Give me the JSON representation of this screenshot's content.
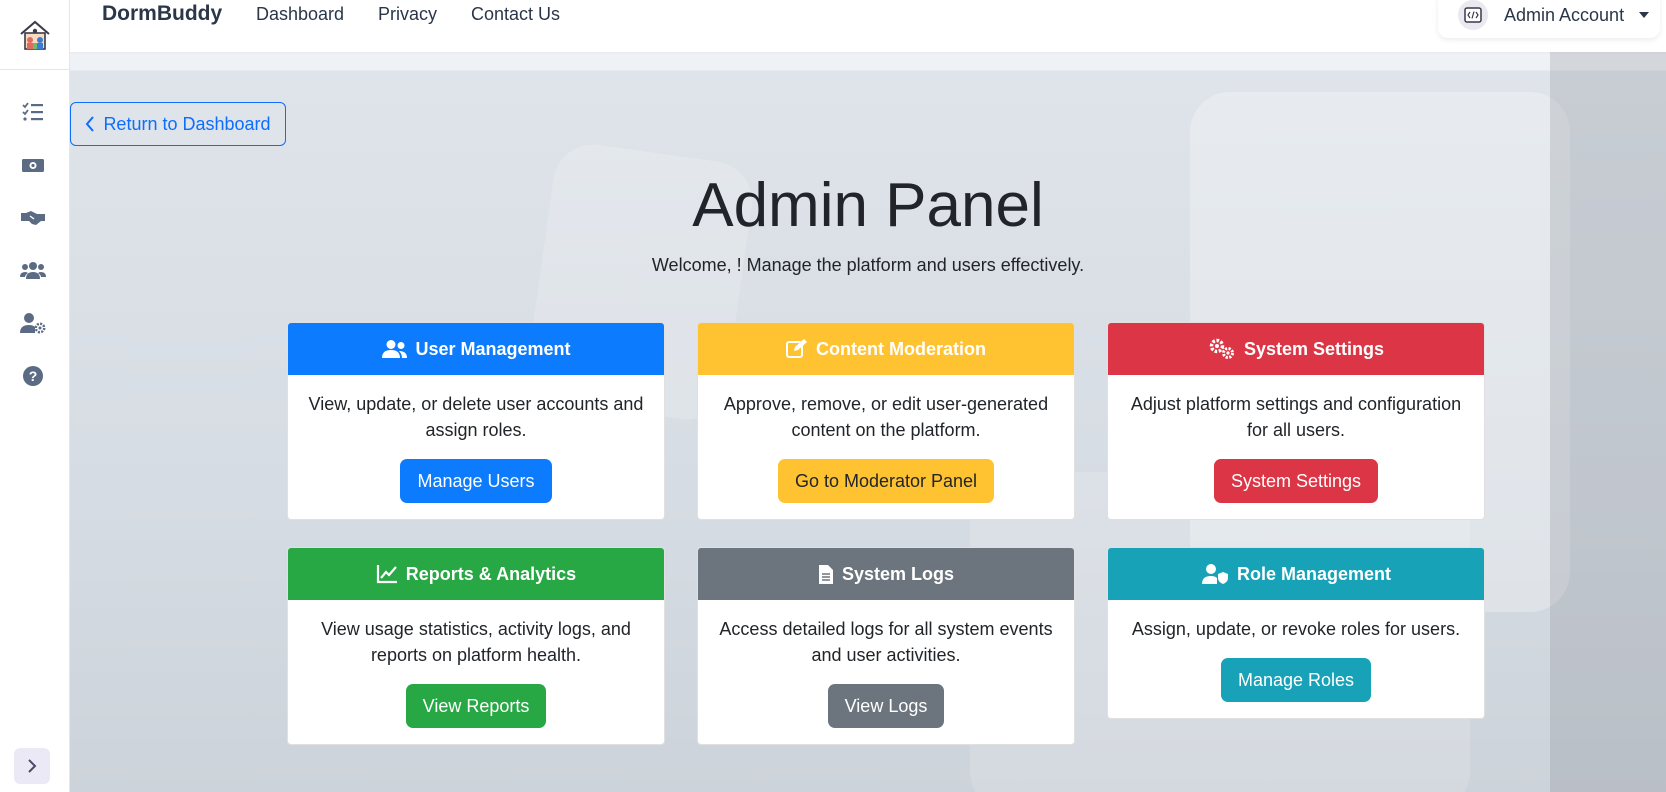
{
  "header": {
    "brand": "DormBuddy",
    "nav": [
      "Dashboard",
      "Privacy",
      "Contact Us"
    ],
    "account_name": "Admin Account"
  },
  "sidebar": {
    "icons": [
      "house-logo-icon",
      "tasks-list-icon",
      "money-icon",
      "handshake-icon",
      "users-icon",
      "user-gear-icon",
      "help-icon"
    ],
    "expand_icon": "chevron-right-icon"
  },
  "main": {
    "back_label": "Return to Dashboard",
    "title": "Admin Panel",
    "welcome": "Welcome, ! Manage the platform and users effectively."
  },
  "cards": [
    {
      "title": "User Management",
      "text": "View, update, or delete user accounts and assign roles.",
      "button": "Manage Users",
      "color": "#0d7bfd",
      "icon": "users-icon"
    },
    {
      "title": "Content Moderation",
      "text": "Approve, remove, or edit user-generated content on the platform.",
      "button": "Go to Moderator Panel",
      "color": "#ffc231",
      "icon": "edit-icon"
    },
    {
      "title": "System Settings",
      "text": "Adjust platform settings and configuration for all users.",
      "button": "System Settings",
      "color": "#dc3545",
      "icon": "gears-icon"
    },
    {
      "title": "Reports & Analytics",
      "text": "View usage statistics, activity logs, and reports on platform health.",
      "button": "View Reports",
      "color": "#28a745",
      "icon": "chart-line-icon"
    },
    {
      "title": "System Logs",
      "text": "Access detailed logs for all system events and user activities.",
      "button": "View Logs",
      "color": "#6c757d",
      "icon": "file-icon"
    },
    {
      "title": "Role Management",
      "text": "Assign, update, or revoke roles for users.",
      "button": "Manage Roles",
      "color": "#17a2b8",
      "icon": "user-shield-icon"
    }
  ]
}
